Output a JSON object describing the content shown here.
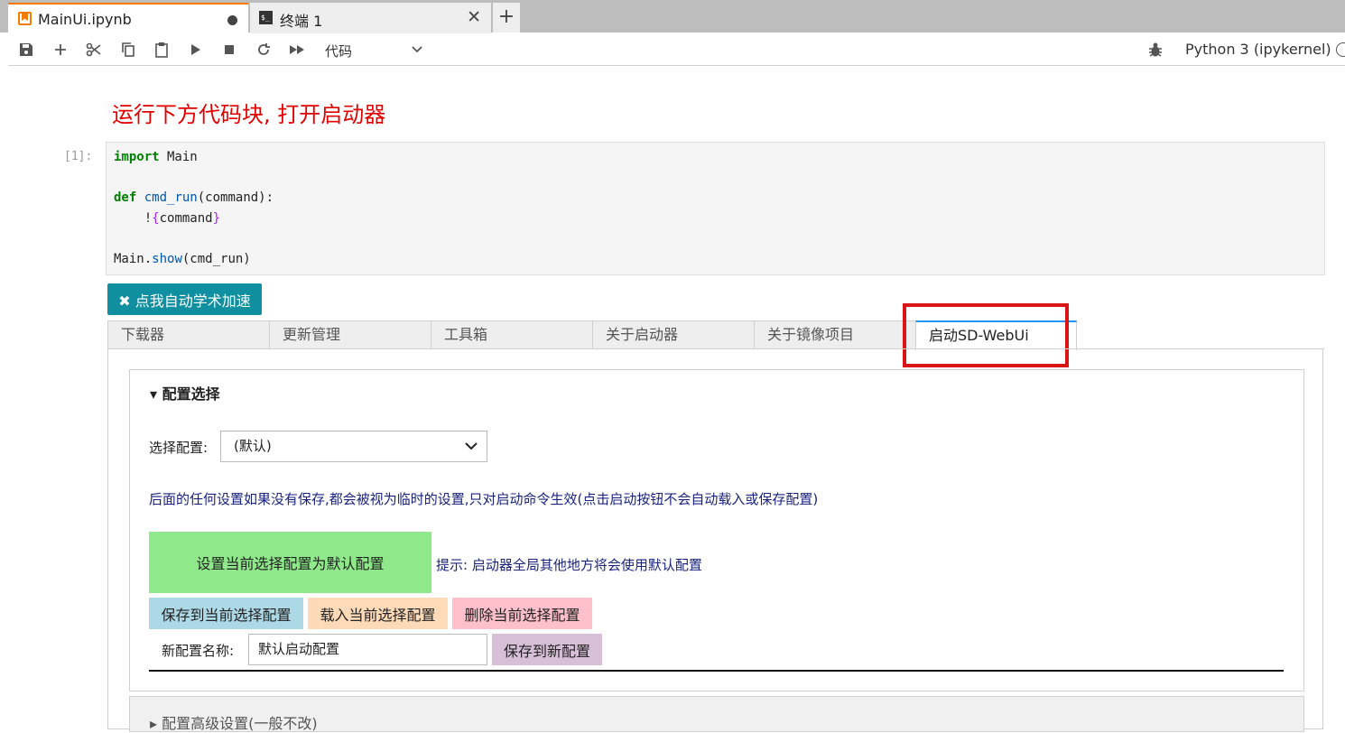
{
  "tabs": [
    {
      "label": "MainUi.ipynb",
      "icon": "notebook-icon"
    },
    {
      "label": "终端 1",
      "icon": "terminal-icon"
    }
  ],
  "add_tab": "+",
  "toolbar": {
    "cell_type": "代码",
    "kernel": "Python 3 (ipykernel)"
  },
  "notebook": {
    "heading": "运行下方代码块, 打开启动器",
    "prompt": "[1]:",
    "code": {
      "l1_kw": "import",
      "l1_rest": " Main",
      "l3_kw": "def",
      "l3_fn": "cmd_run",
      "l3_rest": "(command):",
      "l4_a": "    !",
      "l4_b": "{",
      "l4_c": "command",
      "l4_d": "}",
      "l6_a": "Main.",
      "l6_fn": "show",
      "l6_rest": "(cmd_run)"
    },
    "accel_button": "✖ 点我自动学术加速"
  },
  "widget_tabs": [
    "下载器",
    "更新管理",
    "工具箱",
    "关于启动器",
    "关于镜像项目",
    "启动SD-WebUi"
  ],
  "config": {
    "title": "▾ 配置选择",
    "select_label": "选择配置:",
    "select_value": "(默认)",
    "notice": "后面的任何设置如果没有保存,都会被视为临时的设置,只对启动命令生效(点击启动按钮不会自动载入或保存配置)",
    "set_default": "设置当前选择配置为默认配置",
    "hint": "提示: 启动器全局其他地方将会使用默认配置",
    "save": "保存到当前选择配置",
    "load": "载入当前选择配置",
    "delete": "删除当前选择配置",
    "new_name_label": "新配置名称:",
    "new_name_value": "默认启动配置",
    "save_new": "保存到新配置"
  },
  "advanced": {
    "title": "▸ 配置高级设置(一般不改)"
  },
  "colors": {
    "accent_tab": "#f57c00",
    "heading_red": "#e00000",
    "highlight_red": "#d91515",
    "accel_teal": "#0f8f9f",
    "set_default_green": "#8fe98a",
    "save_blue": "#add8e6",
    "load_peach": "#ffdab9",
    "delete_pink": "#ffc0cb",
    "save_new_thistle": "#d8bfd8"
  }
}
